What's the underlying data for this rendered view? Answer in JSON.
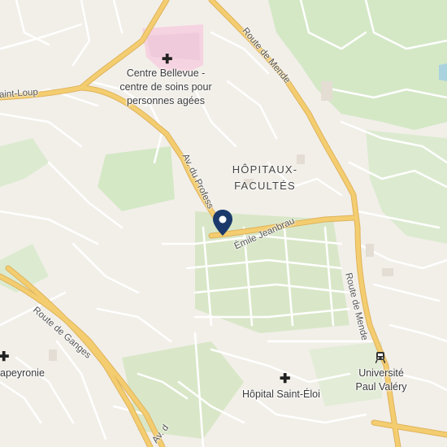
{
  "map": {
    "places": {
      "bellevue": [
        "Centre Bellevue -",
        "centre de soins pour",
        "personnes agées"
      ],
      "district": [
        "HÔPITAUX-",
        "FACULTÉS"
      ],
      "lapeyronie": "apeyronie",
      "saint_eloi": "Hôpital Saint-Éloi",
      "universite": [
        "Université",
        "Paul Valéry"
      ]
    },
    "roads": {
      "route_de_mende_top": "Route de Mende",
      "route_de_mende_right": "Route de Mende",
      "saint_loup": "aint-Loup",
      "av_du_profess": "Av. du Profess",
      "emile_jeanbrau": "Émile Jeanbrau",
      "route_de_ganges": "Route de Ganges",
      "av_bottom": "Av. d"
    },
    "icons": {
      "hospital": "plus-icon",
      "transit": "train-icon",
      "marker": "location-pin-icon"
    },
    "colors": {
      "background": "#f2efe9",
      "main_road": "#f0c867",
      "main_road_casing": "#e1b25a",
      "minor_road": "#ffffff",
      "park": "#cfe5bf",
      "medical": "#f6d3e0",
      "marker": "#1b3a6b"
    }
  }
}
